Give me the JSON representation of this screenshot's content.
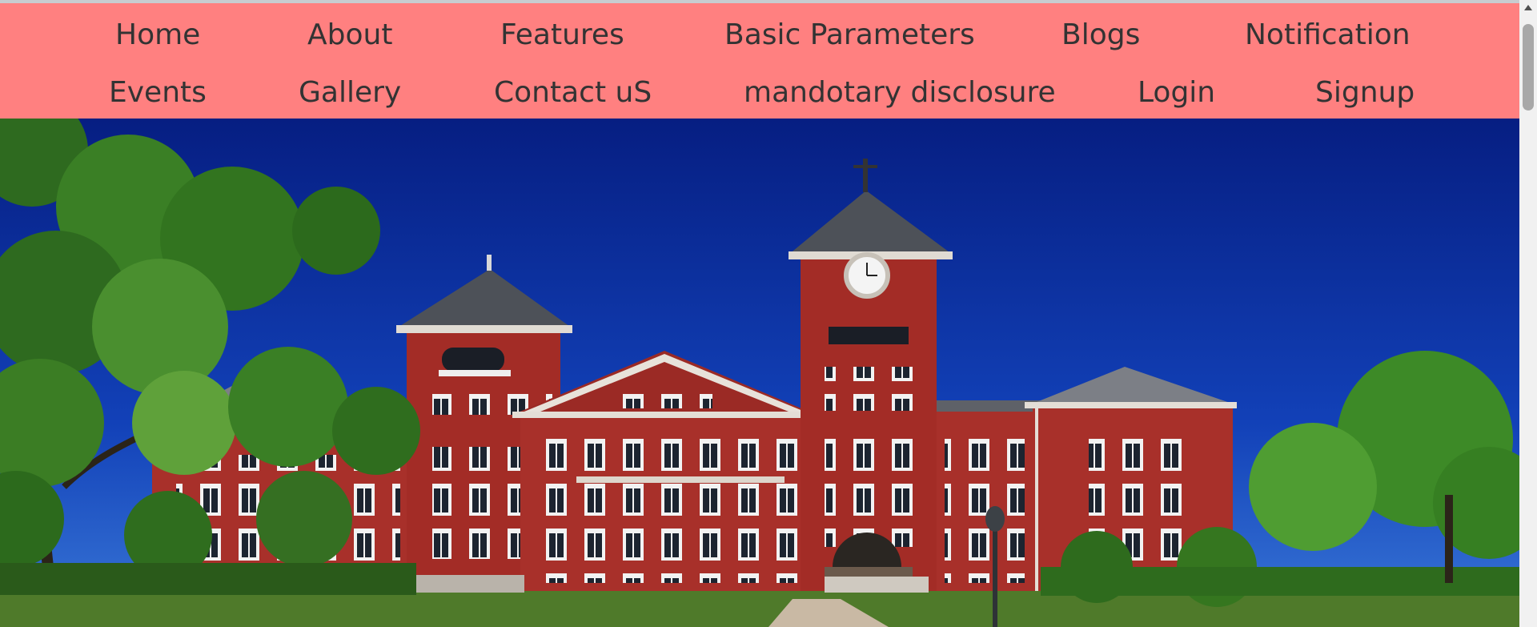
{
  "nav": {
    "row1": [
      "Home",
      "About",
      "Features",
      "Basic Parameters",
      "Blogs",
      "Notification"
    ],
    "row2": [
      "Events",
      "Gallery",
      "Contact uS",
      "mandotary disclosure",
      "Login",
      "Signup"
    ]
  },
  "colors": {
    "navbar_bg": "#ff8080",
    "nav_text": "#333333",
    "sky": "#0a2f9e",
    "brick": "#a8302a"
  },
  "hero": {
    "image": "university-red-brick-clock-tower-building"
  }
}
